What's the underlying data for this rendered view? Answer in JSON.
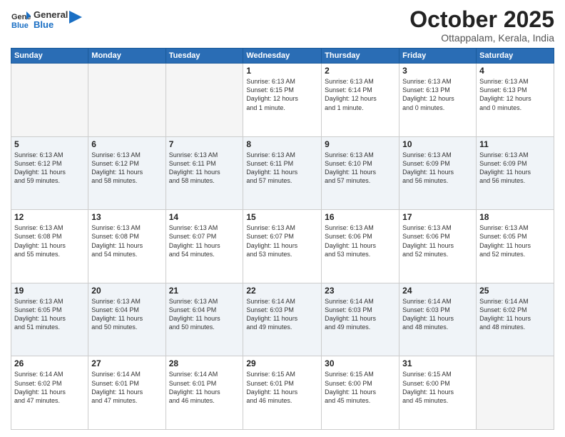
{
  "header": {
    "logo_line1": "General",
    "logo_line2": "Blue",
    "month": "October 2025",
    "location": "Ottappalam, Kerala, India"
  },
  "weekdays": [
    "Sunday",
    "Monday",
    "Tuesday",
    "Wednesday",
    "Thursday",
    "Friday",
    "Saturday"
  ],
  "weeks": [
    [
      {
        "day": "",
        "info": ""
      },
      {
        "day": "",
        "info": ""
      },
      {
        "day": "",
        "info": ""
      },
      {
        "day": "1",
        "info": "Sunrise: 6:13 AM\nSunset: 6:15 PM\nDaylight: 12 hours\nand 1 minute."
      },
      {
        "day": "2",
        "info": "Sunrise: 6:13 AM\nSunset: 6:14 PM\nDaylight: 12 hours\nand 1 minute."
      },
      {
        "day": "3",
        "info": "Sunrise: 6:13 AM\nSunset: 6:13 PM\nDaylight: 12 hours\nand 0 minutes."
      },
      {
        "day": "4",
        "info": "Sunrise: 6:13 AM\nSunset: 6:13 PM\nDaylight: 12 hours\nand 0 minutes."
      }
    ],
    [
      {
        "day": "5",
        "info": "Sunrise: 6:13 AM\nSunset: 6:12 PM\nDaylight: 11 hours\nand 59 minutes."
      },
      {
        "day": "6",
        "info": "Sunrise: 6:13 AM\nSunset: 6:12 PM\nDaylight: 11 hours\nand 58 minutes."
      },
      {
        "day": "7",
        "info": "Sunrise: 6:13 AM\nSunset: 6:11 PM\nDaylight: 11 hours\nand 58 minutes."
      },
      {
        "day": "8",
        "info": "Sunrise: 6:13 AM\nSunset: 6:11 PM\nDaylight: 11 hours\nand 57 minutes."
      },
      {
        "day": "9",
        "info": "Sunrise: 6:13 AM\nSunset: 6:10 PM\nDaylight: 11 hours\nand 57 minutes."
      },
      {
        "day": "10",
        "info": "Sunrise: 6:13 AM\nSunset: 6:09 PM\nDaylight: 11 hours\nand 56 minutes."
      },
      {
        "day": "11",
        "info": "Sunrise: 6:13 AM\nSunset: 6:09 PM\nDaylight: 11 hours\nand 56 minutes."
      }
    ],
    [
      {
        "day": "12",
        "info": "Sunrise: 6:13 AM\nSunset: 6:08 PM\nDaylight: 11 hours\nand 55 minutes."
      },
      {
        "day": "13",
        "info": "Sunrise: 6:13 AM\nSunset: 6:08 PM\nDaylight: 11 hours\nand 54 minutes."
      },
      {
        "day": "14",
        "info": "Sunrise: 6:13 AM\nSunset: 6:07 PM\nDaylight: 11 hours\nand 54 minutes."
      },
      {
        "day": "15",
        "info": "Sunrise: 6:13 AM\nSunset: 6:07 PM\nDaylight: 11 hours\nand 53 minutes."
      },
      {
        "day": "16",
        "info": "Sunrise: 6:13 AM\nSunset: 6:06 PM\nDaylight: 11 hours\nand 53 minutes."
      },
      {
        "day": "17",
        "info": "Sunrise: 6:13 AM\nSunset: 6:06 PM\nDaylight: 11 hours\nand 52 minutes."
      },
      {
        "day": "18",
        "info": "Sunrise: 6:13 AM\nSunset: 6:05 PM\nDaylight: 11 hours\nand 52 minutes."
      }
    ],
    [
      {
        "day": "19",
        "info": "Sunrise: 6:13 AM\nSunset: 6:05 PM\nDaylight: 11 hours\nand 51 minutes."
      },
      {
        "day": "20",
        "info": "Sunrise: 6:13 AM\nSunset: 6:04 PM\nDaylight: 11 hours\nand 50 minutes."
      },
      {
        "day": "21",
        "info": "Sunrise: 6:13 AM\nSunset: 6:04 PM\nDaylight: 11 hours\nand 50 minutes."
      },
      {
        "day": "22",
        "info": "Sunrise: 6:14 AM\nSunset: 6:03 PM\nDaylight: 11 hours\nand 49 minutes."
      },
      {
        "day": "23",
        "info": "Sunrise: 6:14 AM\nSunset: 6:03 PM\nDaylight: 11 hours\nand 49 minutes."
      },
      {
        "day": "24",
        "info": "Sunrise: 6:14 AM\nSunset: 6:03 PM\nDaylight: 11 hours\nand 48 minutes."
      },
      {
        "day": "25",
        "info": "Sunrise: 6:14 AM\nSunset: 6:02 PM\nDaylight: 11 hours\nand 48 minutes."
      }
    ],
    [
      {
        "day": "26",
        "info": "Sunrise: 6:14 AM\nSunset: 6:02 PM\nDaylight: 11 hours\nand 47 minutes."
      },
      {
        "day": "27",
        "info": "Sunrise: 6:14 AM\nSunset: 6:01 PM\nDaylight: 11 hours\nand 47 minutes."
      },
      {
        "day": "28",
        "info": "Sunrise: 6:14 AM\nSunset: 6:01 PM\nDaylight: 11 hours\nand 46 minutes."
      },
      {
        "day": "29",
        "info": "Sunrise: 6:15 AM\nSunset: 6:01 PM\nDaylight: 11 hours\nand 46 minutes."
      },
      {
        "day": "30",
        "info": "Sunrise: 6:15 AM\nSunset: 6:00 PM\nDaylight: 11 hours\nand 45 minutes."
      },
      {
        "day": "31",
        "info": "Sunrise: 6:15 AM\nSunset: 6:00 PM\nDaylight: 11 hours\nand 45 minutes."
      },
      {
        "day": "",
        "info": ""
      }
    ]
  ]
}
